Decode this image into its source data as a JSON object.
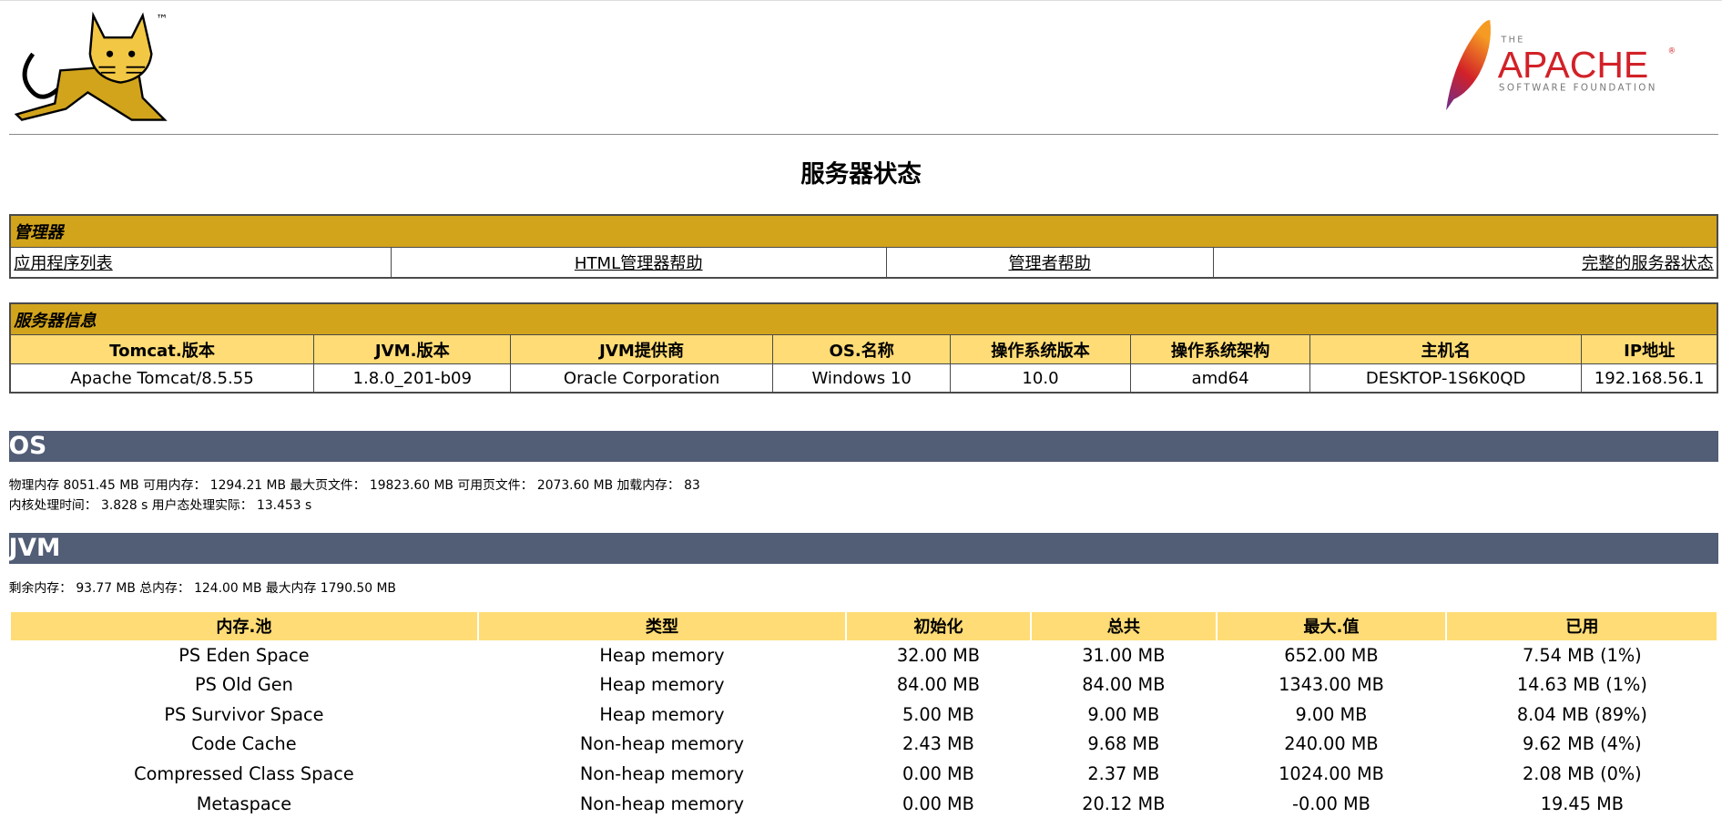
{
  "header": {
    "tomcat_logo": "Tomcat",
    "trademark": "™",
    "apache_logo": {
      "the": "THE",
      "name": "APACHE",
      "sub": "SOFTWARE FOUNDATION",
      "reg": "®"
    }
  },
  "page_title": "服务器状态",
  "manager": {
    "title": "管理器",
    "links": [
      "应用程序列表",
      "HTML管理器帮助",
      "管理者帮助",
      "完整的服务器状态"
    ]
  },
  "server_info": {
    "title": "服务器信息",
    "headers": [
      "Tomcat.版本",
      "JVM.版本",
      "JVM提供商",
      "OS.名称",
      "操作系统版本",
      "操作系统架构",
      "主机名",
      "IP地址"
    ],
    "values": [
      "Apache Tomcat/8.5.55",
      "1.8.0_201-b09",
      "Oracle Corporation",
      "Windows 10",
      "10.0",
      "amd64",
      "DESKTOP-1S6K0QD",
      "192.168.56.1"
    ]
  },
  "os": {
    "title": "OS",
    "line1": "物理内存 8051.45 MB 可用内存： 1294.21 MB 最大页文件： 19823.60 MB 可用页文件： 2073.60 MB 加载内存： 83",
    "line2": "内核处理时间： 3.828 s 用户态处理实际： 13.453 s"
  },
  "jvm": {
    "title": "JVM",
    "line1": "剩余内存： 93.77 MB 总内存： 124.00 MB 最大内存 1790.50 MB"
  },
  "memory_pools": {
    "headers": [
      "内存.池",
      "类型",
      "初始化",
      "总共",
      "最大.值",
      "已用"
    ],
    "rows": [
      [
        "PS Eden Space",
        "Heap memory",
        "32.00 MB",
        "31.00 MB",
        "652.00 MB",
        "7.54 MB (1%)"
      ],
      [
        "PS Old Gen",
        "Heap memory",
        "84.00 MB",
        "84.00 MB",
        "1343.00 MB",
        "14.63 MB (1%)"
      ],
      [
        "PS Survivor Space",
        "Heap memory",
        "5.00 MB",
        "9.00 MB",
        "9.00 MB",
        "8.04 MB (89%)"
      ],
      [
        "Code Cache",
        "Non-heap memory",
        "2.43 MB",
        "9.68 MB",
        "240.00 MB",
        "9.62 MB (4%)"
      ],
      [
        "Compressed Class Space",
        "Non-heap memory",
        "0.00 MB",
        "2.37 MB",
        "1024.00 MB",
        "2.08 MB (0%)"
      ],
      [
        "Metaspace",
        "Non-heap memory",
        "0.00 MB",
        "20.12 MB",
        "-0.00 MB",
        "19.45 MB"
      ]
    ]
  },
  "colors": {
    "manager_title": "#D2A41C",
    "table_header": "#FFDC75",
    "section_bar": "#525D76"
  }
}
